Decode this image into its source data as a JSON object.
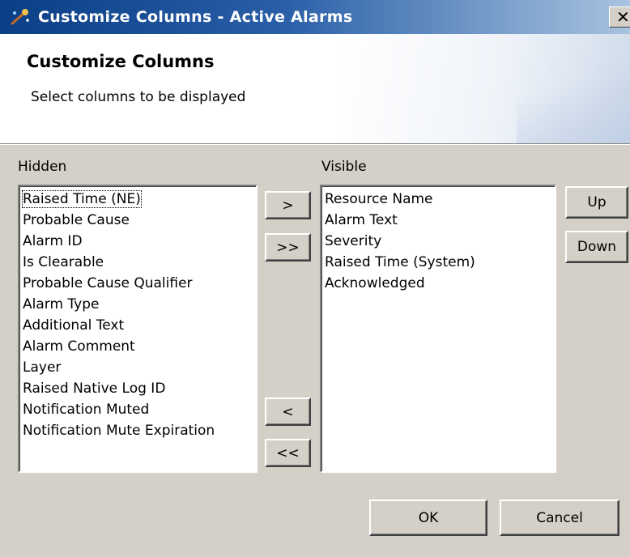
{
  "window": {
    "title": "Customize Columns  - Active Alarms",
    "close_glyph": "✕"
  },
  "banner": {
    "heading": "Customize Columns",
    "subtitle": "Select columns to be displayed"
  },
  "hidden": {
    "label": "Hidden",
    "items": [
      "Raised Time (NE)",
      "Probable Cause",
      "Alarm ID",
      "Is Clearable",
      "Probable Cause Qualifier",
      "Alarm Type",
      "Additional Text",
      "Alarm Comment",
      "Layer",
      "Raised Native Log ID",
      "Notification Muted",
      "Notification Mute Expiration"
    ]
  },
  "visible": {
    "label": "Visible",
    "items": [
      "Resource Name",
      "Alarm Text",
      "Severity",
      "Raised Time (System)",
      "Acknowledged"
    ]
  },
  "buttons": {
    "add_one": ">",
    "add_all": ">>",
    "remove_one": "<",
    "remove_all": "<<",
    "up": "Up",
    "down": "Down",
    "ok": "OK",
    "cancel": "Cancel"
  },
  "icons": {
    "app_icon": "wand-icon"
  },
  "colors": {
    "titlebar_start": "#0a3f86",
    "titlebar_end": "#a9c3e0",
    "dialog_bg": "#d4d0c8"
  }
}
